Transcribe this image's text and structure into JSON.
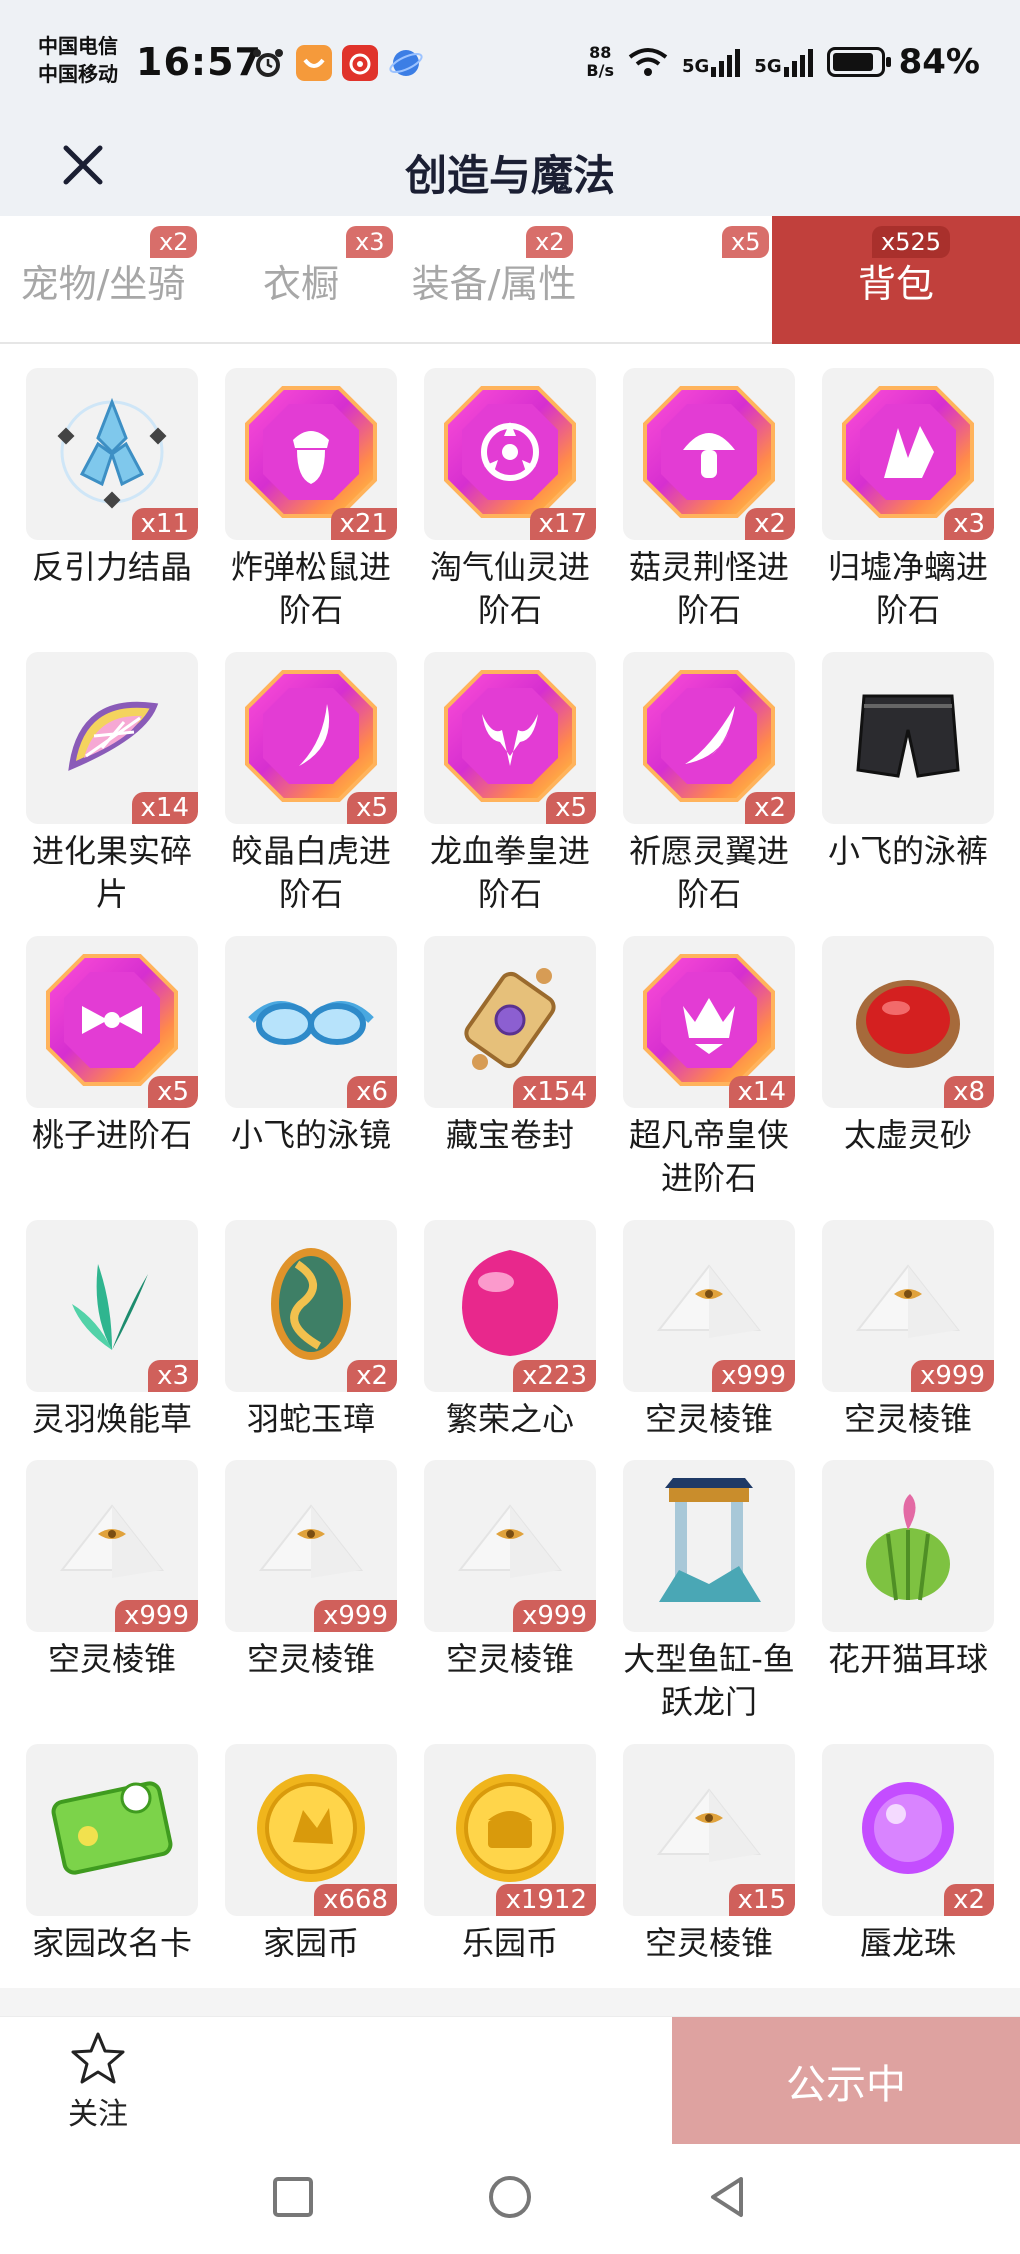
{
  "status_bar": {
    "carrier1": "中国电信",
    "carrier2": "中国移动",
    "time": "16:57",
    "net_speed_value": "88",
    "net_speed_unit": "B/s",
    "sim1": "5G",
    "sim2": "5G",
    "battery": "84%"
  },
  "header": {
    "title": "创造与魔法",
    "close_icon": "close-icon"
  },
  "tabs": [
    {
      "label": "宠物/坐骑",
      "badge": "x2",
      "active": false
    },
    {
      "label": "衣橱",
      "badge": "x3",
      "active": false
    },
    {
      "label": "装备/属性",
      "badge": "x2",
      "active": false
    },
    {
      "label": "",
      "badge": "x5",
      "active": false
    },
    {
      "label": "背包",
      "badge": "x525",
      "active": true
    }
  ],
  "items": [
    {
      "name": "反引力结晶",
      "qty": "x11",
      "icon": "crystal-icon"
    },
    {
      "name": "炸弹松鼠进阶石",
      "qty": "x21",
      "icon": "gem-acorn-icon"
    },
    {
      "name": "淘气仙灵进阶石",
      "qty": "x17",
      "icon": "gem-spirit-icon"
    },
    {
      "name": "菇灵荆怪进阶石",
      "qty": "x2",
      "icon": "gem-mushroom-icon"
    },
    {
      "name": "归墟净螭进阶石",
      "qty": "x3",
      "icon": "gem-wave-icon"
    },
    {
      "name": "进化果实碎片",
      "qty": "x14",
      "icon": "fruit-slice-icon"
    },
    {
      "name": "皎晶白虎进阶石",
      "qty": "x5",
      "icon": "gem-claw-icon"
    },
    {
      "name": "龙血拳皇进阶石",
      "qty": "x5",
      "icon": "gem-bull-icon"
    },
    {
      "name": "祈愿灵翼进阶石",
      "qty": "x2",
      "icon": "gem-wing-icon"
    },
    {
      "name": "小飞的泳裤",
      "qty": "",
      "icon": "swim-trunks-icon"
    },
    {
      "name": "桃子进阶石",
      "qty": "x5",
      "icon": "gem-bow-icon"
    },
    {
      "name": "小飞的泳镜",
      "qty": "x6",
      "icon": "goggles-icon"
    },
    {
      "name": "藏宝卷封",
      "qty": "x154",
      "icon": "scroll-icon"
    },
    {
      "name": "超凡帝皇侠进阶石",
      "qty": "x14",
      "icon": "gem-crown-icon"
    },
    {
      "name": "太虚灵砂",
      "qty": "x8",
      "icon": "red-orb-icon"
    },
    {
      "name": "灵羽焕能草",
      "qty": "x3",
      "icon": "herb-icon"
    },
    {
      "name": "羽蛇玉璋",
      "qty": "x2",
      "icon": "jade-serpent-icon"
    },
    {
      "name": "繁荣之心",
      "qty": "x223",
      "icon": "pink-gem-icon"
    },
    {
      "name": "空灵棱锥",
      "qty": "x999",
      "icon": "pyramid-icon"
    },
    {
      "name": "空灵棱锥",
      "qty": "x999",
      "icon": "pyramid-icon"
    },
    {
      "name": "空灵棱锥",
      "qty": "x999",
      "icon": "pyramid-icon"
    },
    {
      "name": "空灵棱锥",
      "qty": "x999",
      "icon": "pyramid-icon"
    },
    {
      "name": "空灵棱锥",
      "qty": "x999",
      "icon": "pyramid-icon"
    },
    {
      "name": "大型鱼缸-鱼跃龙门",
      "qty": "",
      "icon": "aquarium-icon"
    },
    {
      "name": "花开猫耳球",
      "qty": "",
      "icon": "cactus-icon"
    },
    {
      "name": "家园改名卡",
      "qty": "",
      "icon": "rename-card-icon"
    },
    {
      "name": "家园币",
      "qty": "x668",
      "icon": "gold-coin-icon"
    },
    {
      "name": "乐园币",
      "qty": "x1912",
      "icon": "gold-coin-chest-icon"
    },
    {
      "name": "空灵棱锥",
      "qty": "x15",
      "icon": "pyramid-icon"
    },
    {
      "name": "蜃龙珠",
      "qty": "x2",
      "icon": "purple-orb-icon"
    }
  ],
  "footer": {
    "follow_label": "关注",
    "publish_label": "公示中"
  },
  "colors": {
    "accent": "#c1403c",
    "badge": "#d0605b",
    "publish": "#dea2a0"
  }
}
